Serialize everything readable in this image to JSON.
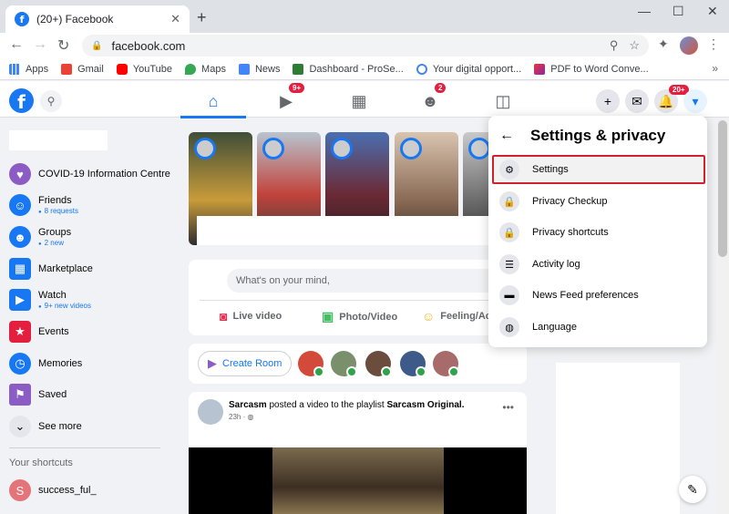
{
  "browser": {
    "tab_title": "(20+) Facebook",
    "url": "facebook.com",
    "bookmarks": [
      "Apps",
      "Gmail",
      "YouTube",
      "Maps",
      "News",
      "Dashboard - ProSe...",
      "Your digital opport...",
      "PDF to Word Conve..."
    ]
  },
  "header": {
    "watch_badge": "9+",
    "groups_badge": "2",
    "notifications_badge": "20+"
  },
  "sidebar": {
    "items": [
      {
        "label": "COVID-19 Information Centre",
        "sub": ""
      },
      {
        "label": "Friends",
        "sub": "8 requests"
      },
      {
        "label": "Groups",
        "sub": "2 new"
      },
      {
        "label": "Marketplace",
        "sub": ""
      },
      {
        "label": "Watch",
        "sub": "9+ new videos"
      },
      {
        "label": "Events",
        "sub": ""
      },
      {
        "label": "Memories",
        "sub": ""
      },
      {
        "label": "Saved",
        "sub": ""
      },
      {
        "label": "See more",
        "sub": ""
      }
    ],
    "shortcuts_heading": "Your shortcuts",
    "shortcut": "success_ful_"
  },
  "composer": {
    "placeholder": "What's on your mind,",
    "live": "Live video",
    "photo": "Photo/Video",
    "feeling": "Feeling/Acti"
  },
  "rooms": {
    "create": "Create Room"
  },
  "post": {
    "author": "Sarcasm",
    "action": " posted a video to the playlist ",
    "playlist": "Sarcasm Original.",
    "time": "23h · "
  },
  "menu": {
    "title": "Settings & privacy",
    "items": [
      "Settings",
      "Privacy Checkup",
      "Privacy shortcuts",
      "Activity log",
      "News Feed preferences",
      "Language"
    ]
  }
}
